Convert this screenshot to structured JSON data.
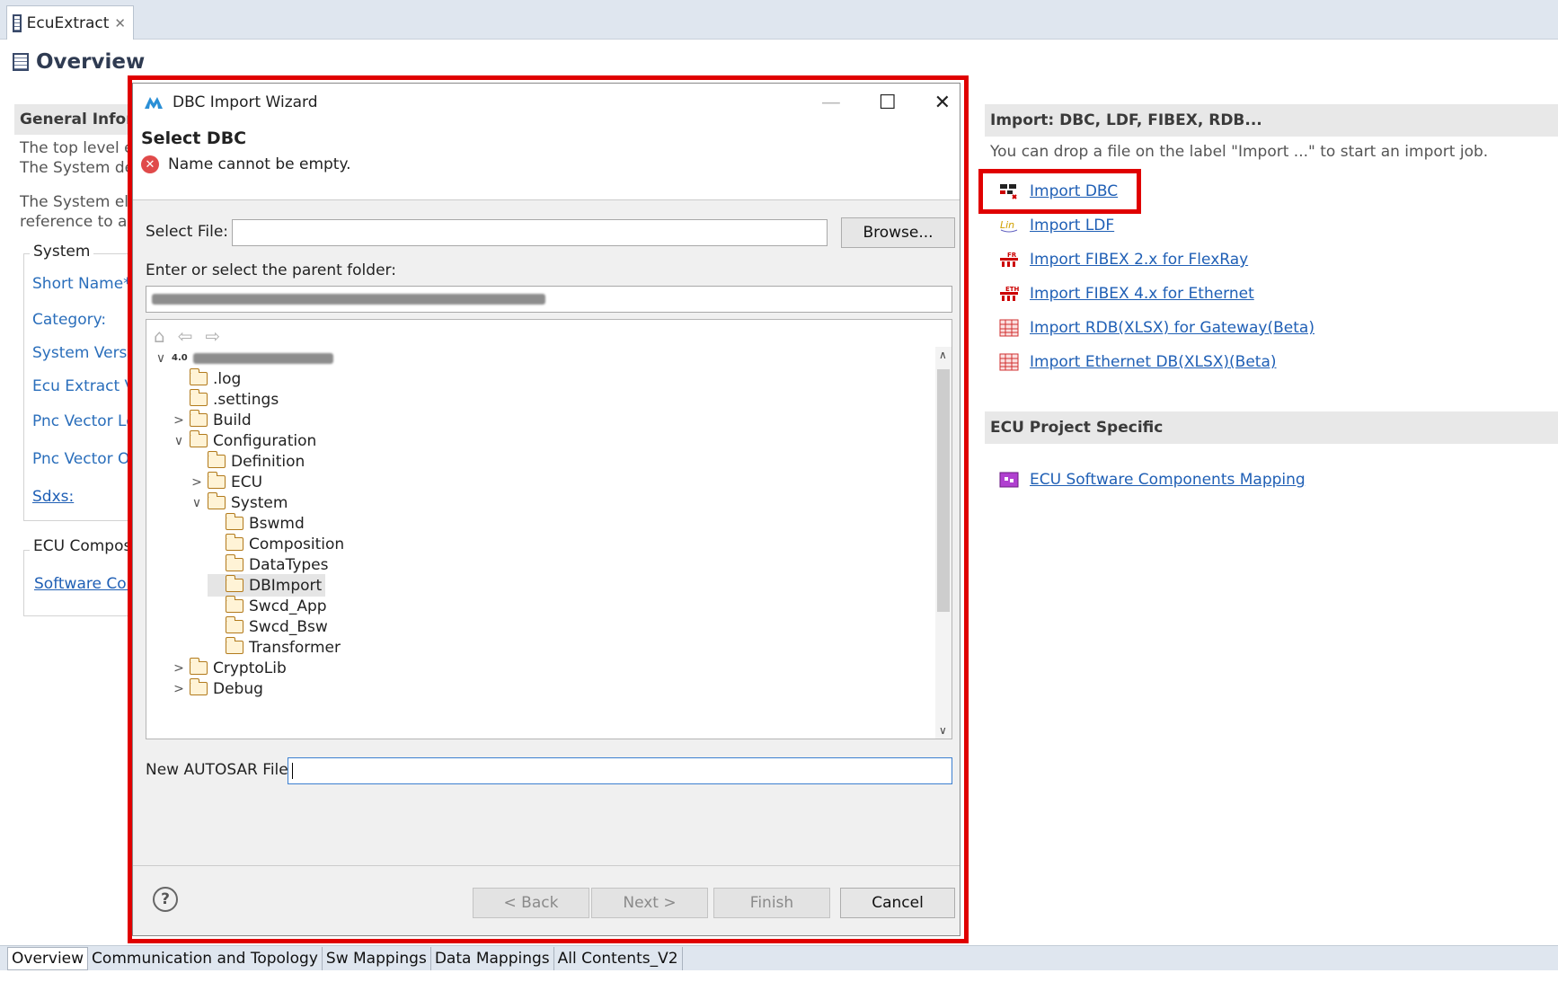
{
  "editor": {
    "tab_label": "EcuExtract",
    "tab_close": "✕",
    "page_title": "Overview"
  },
  "left": {
    "general_header": "General Inform",
    "desc1": "The top level ele",
    "desc2": "The System des",
    "desc3": "The System elem",
    "desc4": "reference to an",
    "system_group": "System",
    "fields": [
      "Short Name*:",
      "Category:",
      "System Versio",
      "Ecu Extract Ve",
      "Pnc Vector Le",
      "Pnc Vector Of"
    ],
    "sdxs_link": "Sdxs:",
    "ecu_group": "ECU Composi",
    "software_link": "Software Com"
  },
  "right": {
    "import_header": "Import: DBC, LDF, FIBEX, RDB...",
    "import_desc": "You can drop a file on the label \"Import ...\" to start an import job.",
    "links": [
      {
        "label": "Import DBC",
        "icon": "dbc-icon"
      },
      {
        "label": "Import LDF",
        "icon": "ldf-icon"
      },
      {
        "label": "Import FIBEX 2.x for FlexRay",
        "icon": "fibex-fr-icon"
      },
      {
        "label": "Import FIBEX 4.x for Ethernet",
        "icon": "fibex-eth-icon"
      },
      {
        "label": "Import RDB(XLSX) for Gateway(Beta)",
        "icon": "rdb-icon"
      },
      {
        "label": "Import Ethernet DB(XLSX)(Beta)",
        "icon": "ethernet-db-icon"
      }
    ],
    "ecu_header": "ECU Project Specific",
    "ecu_link": "ECU Software Components Mapping"
  },
  "dialog": {
    "title": "DBC Import Wizard",
    "heading": "Select DBC",
    "error": "Name cannot be empty.",
    "select_file_label": "Select File:",
    "select_file_value": "",
    "browse": "Browse...",
    "parent_folder_label": "Enter or select the parent folder:",
    "new_file_label": "New AUTOSAR File:",
    "new_file_value": "",
    "help": "?",
    "back": "< Back",
    "next": "Next >",
    "finish": "Finish",
    "cancel": "Cancel",
    "tree": [
      {
        "label": "",
        "depth": 0,
        "twisty": "∨",
        "redacted": true
      },
      {
        "label": ".log",
        "depth": 1,
        "twisty": ""
      },
      {
        "label": ".settings",
        "depth": 1,
        "twisty": ""
      },
      {
        "label": "Build",
        "depth": 1,
        "twisty": ">"
      },
      {
        "label": "Configuration",
        "depth": 1,
        "twisty": "∨"
      },
      {
        "label": "Definition",
        "depth": 2,
        "twisty": ""
      },
      {
        "label": "ECU",
        "depth": 2,
        "twisty": ">"
      },
      {
        "label": "System",
        "depth": 2,
        "twisty": "∨"
      },
      {
        "label": "Bswmd",
        "depth": 3,
        "twisty": ""
      },
      {
        "label": "Composition",
        "depth": 3,
        "twisty": ""
      },
      {
        "label": "DataTypes",
        "depth": 3,
        "twisty": ""
      },
      {
        "label": "DBImport",
        "depth": 3,
        "twisty": "",
        "selected": true
      },
      {
        "label": "Swcd_App",
        "depth": 3,
        "twisty": ""
      },
      {
        "label": "Swcd_Bsw",
        "depth": 3,
        "twisty": ""
      },
      {
        "label": "Transformer",
        "depth": 3,
        "twisty": ""
      },
      {
        "label": "CryptoLib",
        "depth": 1,
        "twisty": ">"
      },
      {
        "label": "Debug",
        "depth": 1,
        "twisty": ">"
      }
    ]
  },
  "bottom_tabs": [
    "Overview",
    "Communication and Topology",
    "Sw Mappings",
    "Data Mappings",
    "All Contents_V2"
  ],
  "colors": {
    "highlight": "#e00000",
    "link": "#1f5fb5"
  }
}
